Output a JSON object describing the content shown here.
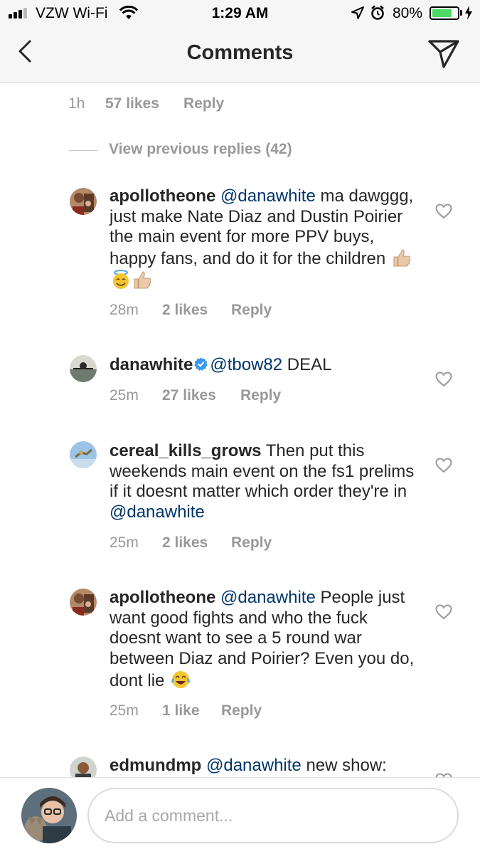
{
  "status_bar": {
    "carrier": "VZW Wi-Fi",
    "time": "1:29 AM",
    "battery_percent": "80%",
    "battery_level": 0.8,
    "icons": [
      "signal-icon",
      "wifi-icon",
      "location-icon",
      "alarm-icon",
      "battery-icon",
      "charging-icon"
    ]
  },
  "nav": {
    "title": "Comments",
    "back_icon": "back-chevron-icon",
    "send_icon": "direct-send-icon"
  },
  "top_meta": {
    "time": "1h",
    "likes": "57 likes",
    "reply": "Reply"
  },
  "view_previous": "View previous replies (42)",
  "comments": [
    {
      "user": "apollotheone",
      "mention": "@danawhite",
      "text": " ma dawggg, just make Nate Diaz and Dustin Poirier the main event for more PPV buys, happy fans, and do it for the children",
      "emojis": [
        "thumbs-up-emoji",
        "smiling-face-with-halo-emoji",
        "thumbs-up-emoji"
      ],
      "time": "28m",
      "likes": "2 likes",
      "reply": "Reply"
    },
    {
      "user": "danawhite",
      "verified": true,
      "mention": "@tbow82",
      "text": " DEAL",
      "time": "25m",
      "likes": "27 likes",
      "reply": "Reply"
    },
    {
      "user": "cereal_kills_grows",
      "text_before": " Then put this weekends main event on the fs1 prelims if it doesnt matter which order they're in ",
      "mention": "@danawhite",
      "time": "25m",
      "likes": "2 likes",
      "reply": "Reply"
    },
    {
      "user": "apollotheone",
      "mention": "@danawhite",
      "text": " People just want good fights and who the fuck doesnt want to see a 5 round war between Diaz and Poirier? Even you do, dont lie",
      "emojis": [
        "face-with-tears-of-joy-emoji"
      ],
      "time": "25m",
      "likes": "1 like",
      "reply": "Reply"
    },
    {
      "user": "edmundmp",
      "mention": "@danawhite",
      "text": " new show:"
    }
  ],
  "footer": {
    "placeholder": "Add a comment..."
  },
  "colors": {
    "text": "#262626",
    "meta": "#999999",
    "mention": "#003569",
    "verified": "#3897f0",
    "battery": "#4cd964",
    "bar_bg": "#f6f6f6"
  }
}
